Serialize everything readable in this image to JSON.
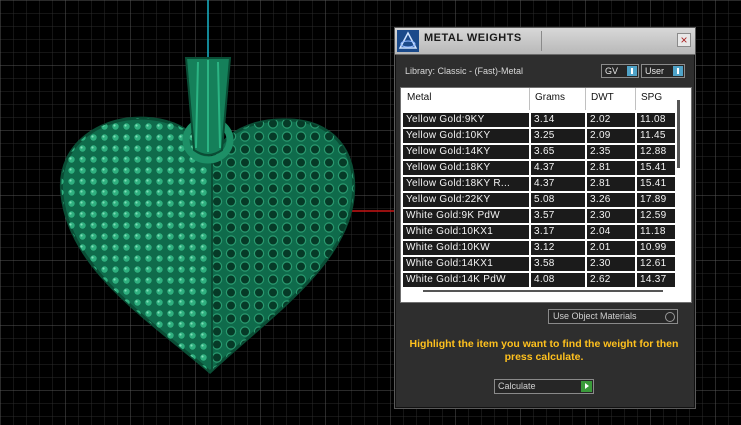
{
  "panel": {
    "title": "METAL WEIGHTS",
    "close_glyph": "×",
    "library": "Library: Classic - (Fast)-Metal",
    "toggles": [
      {
        "label": "GV"
      },
      {
        "label": "User"
      }
    ]
  },
  "table": {
    "headers": [
      "Metal",
      "Grams",
      "DWT",
      "SPG"
    ],
    "rows": [
      [
        "Yellow Gold:9KY",
        "3.14",
        "2.02",
        "11.08"
      ],
      [
        "Yellow Gold:10KY",
        "3.25",
        "2.09",
        "11.45"
      ],
      [
        "Yellow Gold:14KY",
        "3.65",
        "2.35",
        "12.88"
      ],
      [
        "Yellow Gold:18KY",
        "4.37",
        "2.81",
        "15.41"
      ],
      [
        "Yellow Gold:18KY R...",
        "4.37",
        "2.81",
        "15.41"
      ],
      [
        "Yellow Gold:22KY",
        "5.08",
        "3.26",
        "17.89"
      ],
      [
        "White Gold:9K PdW",
        "3.57",
        "2.30",
        "12.59"
      ],
      [
        "White Gold:10KX1",
        "3.17",
        "2.04",
        "11.18"
      ],
      [
        "White Gold:10KW",
        "3.12",
        "2.01",
        "10.99"
      ],
      [
        "White Gold:14KX1",
        "3.58",
        "2.30",
        "12.61"
      ],
      [
        "White Gold:14K PdW",
        "4.08",
        "2.62",
        "14.37"
      ]
    ]
  },
  "material_select": {
    "label": "Use Object Materials"
  },
  "instructions": "Highlight the item you want to find the weight for then press calculate.",
  "calculate_button": {
    "label": "Calculate"
  },
  "colors": {
    "viewport_bg": "#000000",
    "grid": "#4a4a4a",
    "model": "#17835f",
    "axis_red": "#c81414",
    "axis_cyan": "#18b4c8",
    "instruction_text": "#ffc11e"
  },
  "icons": {
    "app_logo": "rhino-gold-logo-icon",
    "close": "close-icon",
    "toggle": "toggle-switch-icon",
    "select": "radio-knob-icon",
    "calculate": "play-arrow-icon"
  }
}
